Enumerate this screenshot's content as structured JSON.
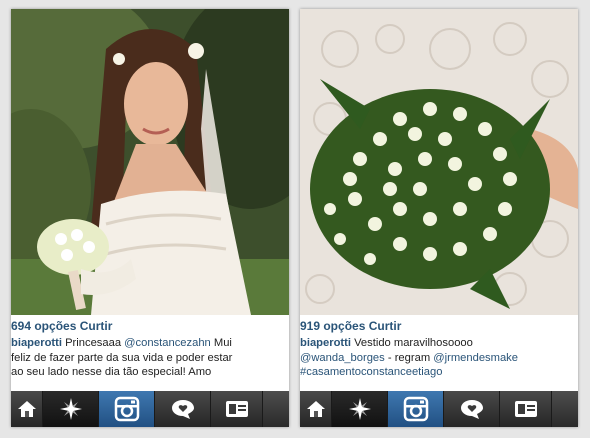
{
  "posts": [
    {
      "likes": "694 opções Curtir",
      "caption": {
        "user": "biaperotti",
        "line1_text": " Princesaaa ",
        "line1_mention": "@constancezahn",
        "line1_after": " Mui",
        "line2": "feliz de fazer parte da sua vida e poder estar",
        "line3": "ao seu lado nesse dia tão especial! Amo"
      }
    },
    {
      "likes": "919 opções Curtir",
      "caption": {
        "user": "biaperotti",
        "line1_text": " Vestido maravilhosoooo",
        "line2_mention1": "@wanda_borges",
        "line2_text": " - regram ",
        "line2_mention2": "@jrmendesmake",
        "line3": "#casamentoconstanceetiago"
      }
    }
  ],
  "tabbar": [
    "home-icon",
    "explore-icon",
    "camera-icon",
    "activity-icon",
    "profile-icon"
  ],
  "colors": {
    "link": "#2a5478",
    "active_tab": "#3068a0",
    "tabbar": "#333333"
  }
}
